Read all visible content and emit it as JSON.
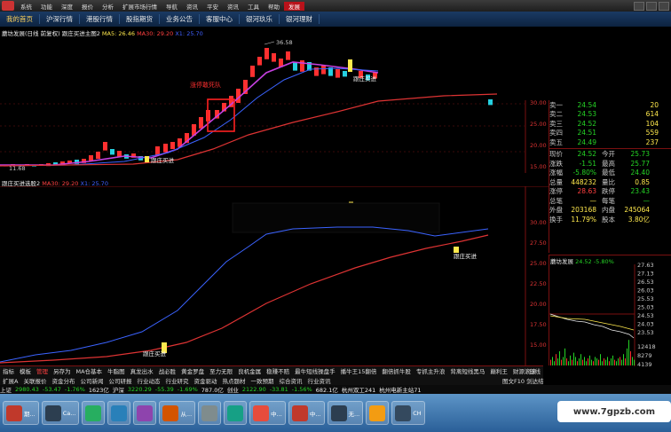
{
  "menubar": {
    "items": [
      "系统",
      "功能",
      "深度",
      "报价",
      "分析",
      "扩展市场行情",
      "导航",
      "资讯",
      "平安",
      "资讯",
      "工具",
      "帮助",
      "发展"
    ],
    "active_index": 12
  },
  "navbar": {
    "items": [
      "我的首页",
      "沪深行情",
      "港股行情",
      "股指期货",
      "业务公告",
      "客服中心",
      "银河玖乐",
      "银河理财"
    ],
    "active_index": 0
  },
  "main_chart": {
    "title": "蘑坊发展(日线 前复权) 跟庄买进主图2",
    "ma5_label": "MA5: 26.46",
    "ma30_label": "MA30: 29.20",
    "x_label": "X1: 25.70",
    "high_label": "36.58",
    "low_label": "11.68",
    "annotation": "涨停敢死队",
    "marker_label": "跟庄买进",
    "marker_label2": "跟庄买进",
    "y_ticks": [
      "30.00",
      "25.00",
      "20.00",
      "15.00"
    ]
  },
  "sub_chart": {
    "title": "跟庄买进选股2",
    "ma30_label": "MA30: 29.20",
    "x_label": "X1: 25.70",
    "marker_label": "跟庄买进",
    "marker_label2": "跟庄买进",
    "y_ticks": [
      "30.00",
      "27.50",
      "25.00",
      "22.50",
      "20.00",
      "17.50",
      "15.00"
    ]
  },
  "quote": {
    "asks": [
      {
        "label": "卖一",
        "price": "24.54",
        "vol": "20"
      },
      {
        "label": "卖二",
        "price": "24.53",
        "vol": "614"
      },
      {
        "label": "卖三",
        "price": "24.52",
        "vol": "104"
      },
      {
        "label": "卖四",
        "price": "24.51",
        "vol": "559"
      },
      {
        "label": "卖五",
        "price": "24.49",
        "vol": "237"
      }
    ],
    "stats": [
      {
        "l": "现价",
        "v": "24.52",
        "l2": "今开",
        "v2": "25.73"
      },
      {
        "l": "涨跌",
        "v": "-1.51",
        "l2": "最高",
        "v2": "25.77"
      },
      {
        "l": "涨幅",
        "v": "-5.80%",
        "l2": "最低",
        "v2": "24.40"
      },
      {
        "l": "总量",
        "v": "448232",
        "l2": "量比",
        "v2": "0.85"
      },
      {
        "l": "涨停",
        "v": "28.63",
        "l2": "跌停",
        "v2": "23.43"
      },
      {
        "l": "总笔",
        "v": "—",
        "l2": "每笔",
        "v2": "—"
      },
      {
        "l": "外盘",
        "v": "203168",
        "l2": "内盘",
        "v2": "245064"
      },
      {
        "l": "换手",
        "v": "11.79%",
        "l2": "股本",
        "v2": "3.80亿"
      }
    ]
  },
  "intraday": {
    "title": "蘑坊发展",
    "price": "24.52",
    "pct": "-5.80%",
    "price_ticks": [
      "27.63",
      "27.13",
      "26.53",
      "26.03",
      "25.53",
      "25.03",
      "24.53",
      "24.03",
      "23.53"
    ],
    "vol_ticks": [
      "12418",
      "8279",
      "4139"
    ]
  },
  "bottombar1": {
    "items": [
      "指标",
      "模板",
      "管理",
      "另存为",
      "MA仓基本",
      "牛脂图",
      "真龙出水",
      "战必胜",
      "黄金罗盘",
      "至力无限",
      "良机金属",
      "稳赚不赔",
      "最牛短线操盘手",
      "播牛王15翻倍",
      "翻倍抓牛股",
      "专抓主升浪",
      "背离短线黑马",
      "巅利王",
      "财源滚滚"
    ],
    "active_index": 2,
    "right_label": "日线"
  },
  "bottombar2": {
    "items": [
      "扩展A",
      "关联报价",
      "资金分布",
      "公司新闻",
      "公司研报",
      "行业动态",
      "行业研究",
      "资金驱动",
      "热点题材",
      "一致预期",
      "综合资讯",
      "行业资讯"
    ],
    "right_label": "图文F10 剑达结"
  },
  "indexbar": {
    "items": [
      {
        "t": "上证",
        "c": "white"
      },
      {
        "t": "2980.43",
        "c": "green"
      },
      {
        "t": "-53.47",
        "c": "green"
      },
      {
        "t": "-1.76%",
        "c": "green"
      },
      {
        "t": "1623亿",
        "c": "white"
      },
      {
        "t": "沪深",
        "c": "white"
      },
      {
        "t": "3220.29",
        "c": "green"
      },
      {
        "t": "-55.39",
        "c": "green"
      },
      {
        "t": "-1.69%",
        "c": "green"
      },
      {
        "t": "787.0亿",
        "c": "white"
      },
      {
        "t": "创业",
        "c": "white"
      },
      {
        "t": "2122.90",
        "c": "green"
      },
      {
        "t": "-33.81",
        "c": "green"
      },
      {
        "t": "-1.56%",
        "c": "green"
      },
      {
        "t": "682.1亿",
        "c": "white"
      },
      {
        "t": "杭州双工241",
        "c": "white"
      },
      {
        "t": "杭州电新主站71",
        "c": "white"
      }
    ]
  },
  "taskbar": {
    "items": [
      {
        "label": "期...",
        "color": "#c0392b"
      },
      {
        "label": "Ca...",
        "color": "#2c3e50"
      },
      {
        "label": "",
        "color": "#27ae60"
      },
      {
        "label": "",
        "color": "#2980b9"
      },
      {
        "label": "",
        "color": "#8e44ad"
      },
      {
        "label": "从...",
        "color": "#d35400"
      },
      {
        "label": "",
        "color": "#7f8c8d"
      },
      {
        "label": "",
        "color": "#16a085"
      },
      {
        "label": "中...",
        "color": "#e74c3c"
      },
      {
        "label": "中...",
        "color": "#c0392b"
      },
      {
        "label": "无...",
        "color": "#2c3e50"
      },
      {
        "label": "",
        "color": "#f39c12"
      },
      {
        "label": "CH",
        "color": "#34495e"
      }
    ]
  },
  "watermark": "www.7gpzb.com"
}
